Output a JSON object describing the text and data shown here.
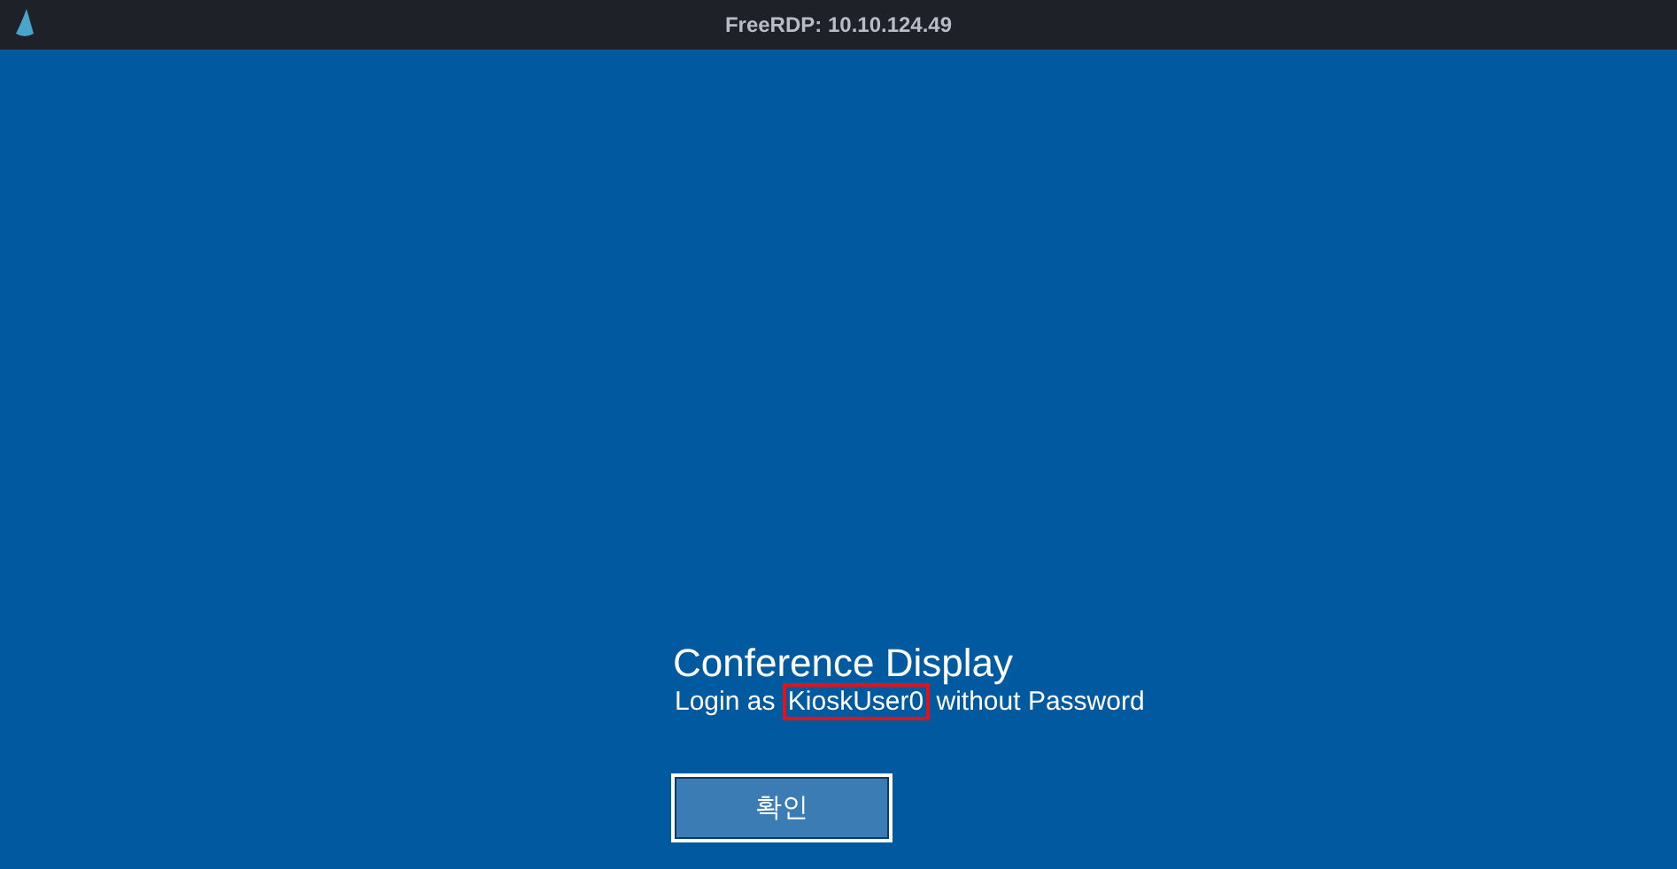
{
  "window": {
    "title": "FreeRDP: 10.10.124.49"
  },
  "screen": {
    "heading": "Conference Display",
    "message": {
      "before": "Login as ",
      "highlighted": "KioskUser0",
      "after": " without Password"
    },
    "button": "확인"
  }
}
